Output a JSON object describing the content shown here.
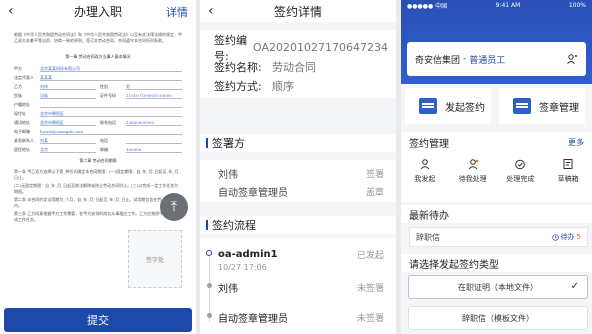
{
  "p1": {
    "back": "‹",
    "title": "办理入职",
    "action": "详情",
    "intro": "根据《中华人民共和国劳动合同法》和《中华人民共和国劳动法》以及有关法律法规的规定，甲乙双方本着平等自愿、协商一致的原则，签订本劳动合同，共同遵守本合同所列条款。",
    "section1": "第一章  劳动合同双方当事人基本情况",
    "fields": [
      {
        "label": "甲方",
        "value": "北京某某科技有限公司",
        "label2": "",
        "value2": ""
      },
      {
        "label": "法定代表人",
        "value": "某某某",
        "label2": "",
        "value2": ""
      },
      {
        "label": "乙方",
        "value": "刘伟",
        "label2": "性别",
        "value2": "男"
      },
      {
        "label": "民族",
        "value": "汉族",
        "label2": "证件号码",
        "value2": "110107199001010000"
      },
      {
        "label": "户籍地址",
        "value": "",
        "label2": "",
        "value2": ""
      },
      {
        "label": "现住址",
        "value": "北京市朝阳区",
        "label2": "",
        "value2": ""
      },
      {
        "label": "通讯地址",
        "value": "北京市朝阳区",
        "label2": "联系电话",
        "value2": "13800000000"
      },
      {
        "label": "电子邮箱",
        "value": "liuwei@example.com",
        "label2": "",
        "value2": ""
      },
      {
        "label": "紧急联系人",
        "value": "刘某",
        "label2": "电话",
        "value2": ""
      },
      {
        "label": "居住地址",
        "value": "北京",
        "label2": "邮编",
        "value2": "100000"
      }
    ],
    "section2": "第二章  劳动合同期限",
    "paras": [
      "第一条  甲乙双方选择以下第_种形式确定本合同期限：(一)固定期限：自_年_月_日起至_年_月_日止。",
      "(二)无固定期限：自_年_月_日起至依法解除或终止劳动合同时止。(三)以完成一定工作任务为期限。",
      "第二条  本合同约定试用期为_个月，自_年_月_日起至_年_月_日止。试用期包含在劳动合同期限内。",
      "第三条  乙方同意根据甲方工作需要，在甲方安排的岗位从事相应工作。乙方应按照甲方要求完成工作任务。"
    ],
    "stamp": "签字处",
    "fab_icon": "⤒",
    "submit": "提交"
  },
  "p2": {
    "back": "‹",
    "title": "签约详情",
    "info": [
      {
        "k": "签约编号:",
        "v": "OA20201027170647234"
      },
      {
        "k": "签约名称:",
        "v": "劳动合同"
      },
      {
        "k": "签约方式:",
        "v": "顺序"
      }
    ],
    "signers_title": "签署方",
    "signers": [
      {
        "name": "刘伟",
        "status": "签署"
      },
      {
        "name": "自动签章管理员",
        "status": "盖章"
      }
    ],
    "flow_title": "签约流程",
    "flow": [
      {
        "name": "oa-admin1",
        "status": "已发起",
        "time": "10/27 17:06"
      },
      {
        "name": "刘伟",
        "status": "未签署",
        "time": ""
      },
      {
        "name": "自动签章管理员",
        "status": "未签署",
        "time": ""
      }
    ]
  },
  "p3": {
    "status_left": "●●●●● 中国 ",
    "status_time": "9:41 AM",
    "status_right": "100%",
    "org": "奇安信集团",
    "sep": "-",
    "role": "普通员工",
    "quick": [
      {
        "label": "发起签约",
        "icon": "document-icon"
      },
      {
        "label": "签章管理",
        "icon": "stamp-icon"
      }
    ],
    "manage_title": "签约管理",
    "more": "更多",
    "grid": [
      {
        "label": "我发起",
        "icon": "user-icon"
      },
      {
        "label": "待我处理",
        "icon": "pending-icon"
      },
      {
        "label": "处理完成",
        "icon": "done-icon"
      },
      {
        "label": "草稿箱",
        "icon": "draft-icon"
      }
    ],
    "todo_title": "最新待办",
    "todo_item": "辞职信",
    "todo_badge": "待办",
    "todo_count": "5",
    "types_title": "请选择发起签约类型",
    "types": [
      {
        "label": "在职证明（本地文件）",
        "selected": true
      },
      {
        "label": "辞职信（模板文件）",
        "selected": false
      }
    ],
    "accent": "#1d4aa8"
  }
}
